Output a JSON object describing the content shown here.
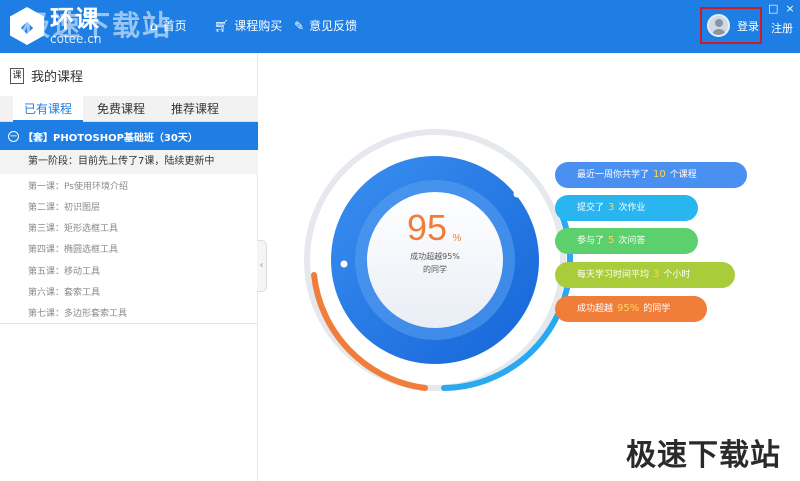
{
  "app": {
    "logo_glyph": "◆",
    "logo_main": "环课",
    "logo_sub": "cotee.cn",
    "watermark_top": "极速下载站"
  },
  "nav": {
    "home": "首页",
    "purchase": "课程购买",
    "feedback": "意见反馈",
    "home_icon": "home-icon",
    "cart_icon": "cart-icon",
    "pencil_icon": "pencil-icon"
  },
  "user": {
    "login": "登录",
    "register": "注册"
  },
  "window": {
    "restore": "□",
    "close": "×"
  },
  "sidebar": {
    "title": "我的课程",
    "title_icon": "课",
    "tabs": [
      "已有课程",
      "免费课程",
      "推荐课程"
    ],
    "active_tab": 0,
    "course": {
      "toggle": "−",
      "title": "【套】PHOTOSHOP基础班（30天）"
    },
    "stage": "第一阶段：目前先上传了7课，陆续更新中",
    "lessons": [
      "第一课：Ps使用环境介绍",
      "第二课：初识图层",
      "第三课：矩形选框工具",
      "第四课：椭圆选框工具",
      "第五课：移动工具",
      "第六课：套索工具",
      "第七课：多边形套索工具"
    ],
    "collapse_arrow": "‹"
  },
  "stats": {
    "percent": "95",
    "percent_sign": "%",
    "caption_line1": "成功超越95%",
    "caption_line2": "的同学",
    "progress": 0.95,
    "pills": [
      {
        "pre": "最近一周你共学了",
        "num": "10",
        "post": "个课程",
        "color": "#4a90f0"
      },
      {
        "pre": "提交了",
        "num": "3",
        "post": "次作业",
        "color": "#29b6f0"
      },
      {
        "pre": "参与了",
        "num": "5",
        "post": "次问答",
        "color": "#5bd06c"
      },
      {
        "pre": "每天学习时间平均",
        "num": "3",
        "post": "个小时",
        "color": "#a8cc3a"
      },
      {
        "pre": "成功超越",
        "num": "95%",
        "post": "的同学",
        "color": "#f07d3a"
      }
    ]
  },
  "watermark_bottom": "极速下载站",
  "colors": {
    "brand": "#1e7ee3",
    "orange": "#f07d3a",
    "highlight": "#ffd55a"
  }
}
